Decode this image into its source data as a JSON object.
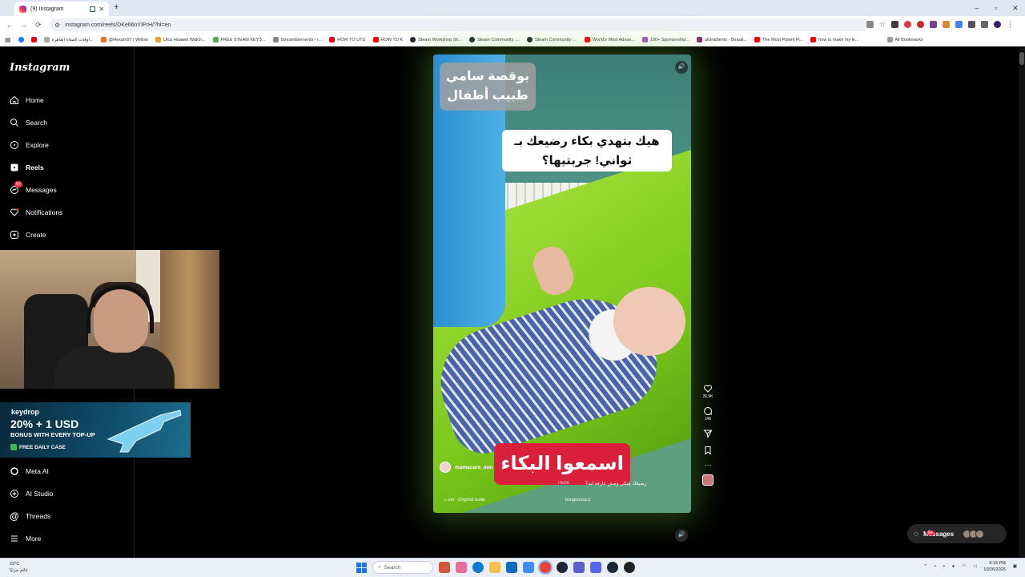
{
  "browser": {
    "tab_title": "(9) Instagram",
    "url": "instagram.com/reels/DKe66nYIPrH/?hl=en",
    "bookmarks": [
      "اوقات الصلاة القاهرة...",
      "@Hexam97 | Willow",
      "Utca Huawei Watch...",
      "FREE STEAM KEYS...",
      "StreamElements - r...",
      "HOW TO UTU",
      "HOW TO K",
      "Steam Workshop Sh...",
      "Steam Community :...",
      "Steam Community :...",
      "World's Most Advan...",
      "100+ Sponsorship...",
      "uiGradients - Beauti...",
      "The Most Potent Fl...",
      "how to make my le..."
    ],
    "all_bookmarks": "All Bookmarks"
  },
  "instagram": {
    "logo": "Instagram",
    "nav_top": [
      {
        "label": "Home",
        "icon": "home-icon"
      },
      {
        "label": "Search",
        "icon": "search-icon"
      },
      {
        "label": "Explore",
        "icon": "compass-icon"
      },
      {
        "label": "Reels",
        "icon": "reels-icon"
      },
      {
        "label": "Messages",
        "icon": "messenger-icon",
        "badge": "9+"
      },
      {
        "label": "Notifications",
        "icon": "heart-icon"
      },
      {
        "label": "Create",
        "icon": "plus-icon"
      }
    ],
    "nav_bottom": [
      {
        "label": "Meta AI",
        "icon": "meta-ai-icon"
      },
      {
        "label": "AI Studio",
        "icon": "ai-studio-icon"
      },
      {
        "label": "Threads",
        "icon": "threads-icon"
      },
      {
        "label": "More",
        "icon": "menu-icon"
      }
    ]
  },
  "keydrop_ad": {
    "brand": "keydrop",
    "headline": "20% + 1 USD",
    "subline": "BONUS WITH EVERY TOP-UP",
    "pill": "FREE DAILY CASE"
  },
  "reel": {
    "caption_top_left": "بوقصة سامي\nطبيب أطفال",
    "caption_top_right": "هيك بتهدي بكاء رضيعك بـ\nثواني! جربتيها؟",
    "caption_bottom": "اسمعوا البكاء",
    "author": "mamacare_mm",
    "description": "رضيعك بيبكي ومش عارفة ليه؟",
    "more": "more",
    "audio": "♫ am · Original audio",
    "location": "bouguessa.s",
    "likes": "26.9K",
    "comments": "146"
  },
  "messages_pill": {
    "label": "Messages",
    "badge": "9+"
  },
  "taskbar": {
    "temp": "23°C",
    "condition": "غائم جزئيًا",
    "search": "Search",
    "time": "9:15 PM",
    "date": "10/26/2025"
  }
}
